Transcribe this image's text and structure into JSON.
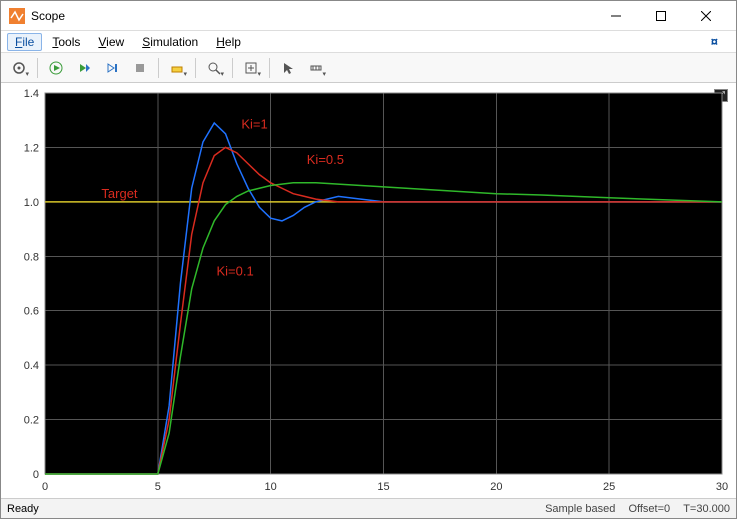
{
  "window": {
    "title": "Scope"
  },
  "menu": {
    "file": "File",
    "tools": "Tools",
    "view": "View",
    "simulation": "Simulation",
    "help": "Help"
  },
  "toolbar_icons": {
    "settings": "settings",
    "run": "run",
    "forward": "forward",
    "step": "step",
    "stop": "stop",
    "highlight": "highlight",
    "zoom": "zoom",
    "fit": "fit",
    "cursor": "cursor",
    "measure": "measure"
  },
  "status": {
    "ready": "Ready",
    "sample": "Sample based",
    "offset": "Offset=0",
    "time": "T=30.000"
  },
  "annotations": {
    "target": "Target",
    "ki1": "Ki=1",
    "ki05": "Ki=0.5",
    "ki01": "Ki=0.1"
  },
  "chart_data": {
    "type": "line",
    "title": "",
    "xlabel": "",
    "ylabel": "",
    "xlim": [
      0,
      30
    ],
    "ylim": [
      0,
      1.4
    ],
    "xticks": [
      0,
      5,
      10,
      15,
      20,
      25,
      30
    ],
    "yticks": [
      0,
      0.2,
      0.4,
      0.6,
      0.8,
      1.0,
      1.2,
      1.4
    ],
    "x": [
      0,
      1,
      2,
      3,
      4,
      5,
      5.5,
      6,
      6.5,
      7,
      7.5,
      8,
      8.5,
      9,
      9.5,
      10,
      10.5,
      11,
      11.5,
      12,
      13,
      14,
      15,
      16,
      18,
      20,
      22,
      25,
      30
    ],
    "series": [
      {
        "name": "Target",
        "color": "#d8c62a",
        "values": [
          1,
          1,
          1,
          1,
          1,
          1,
          1,
          1,
          1,
          1,
          1,
          1,
          1,
          1,
          1,
          1,
          1,
          1,
          1,
          1,
          1,
          1,
          1,
          1,
          1,
          1,
          1,
          1,
          1
        ]
      },
      {
        "name": "Ki=1",
        "color": "#1f72ff",
        "values": [
          0,
          0,
          0,
          0,
          0,
          0,
          0.25,
          0.7,
          1.05,
          1.22,
          1.29,
          1.25,
          1.14,
          1.05,
          0.98,
          0.94,
          0.93,
          0.95,
          0.98,
          1.0,
          1.02,
          1.01,
          1.0,
          1.0,
          1.0,
          1.0,
          1.0,
          1.0,
          1.0
        ]
      },
      {
        "name": "Ki=0.5",
        "color": "#d92b1f",
        "values": [
          0,
          0,
          0,
          0,
          0,
          0,
          0.2,
          0.55,
          0.88,
          1.07,
          1.17,
          1.2,
          1.18,
          1.14,
          1.1,
          1.07,
          1.05,
          1.03,
          1.02,
          1.01,
          1.0,
          1.0,
          1.0,
          1.0,
          1.0,
          1.0,
          1.0,
          1.0,
          1.0
        ]
      },
      {
        "name": "Ki=0.1",
        "color": "#2fb82a",
        "values": [
          0,
          0,
          0,
          0,
          0,
          0,
          0.15,
          0.43,
          0.68,
          0.83,
          0.93,
          0.99,
          1.02,
          1.04,
          1.05,
          1.06,
          1.065,
          1.07,
          1.07,
          1.07,
          1.065,
          1.06,
          1.055,
          1.05,
          1.04,
          1.03,
          1.025,
          1.015,
          1.0
        ]
      }
    ]
  }
}
